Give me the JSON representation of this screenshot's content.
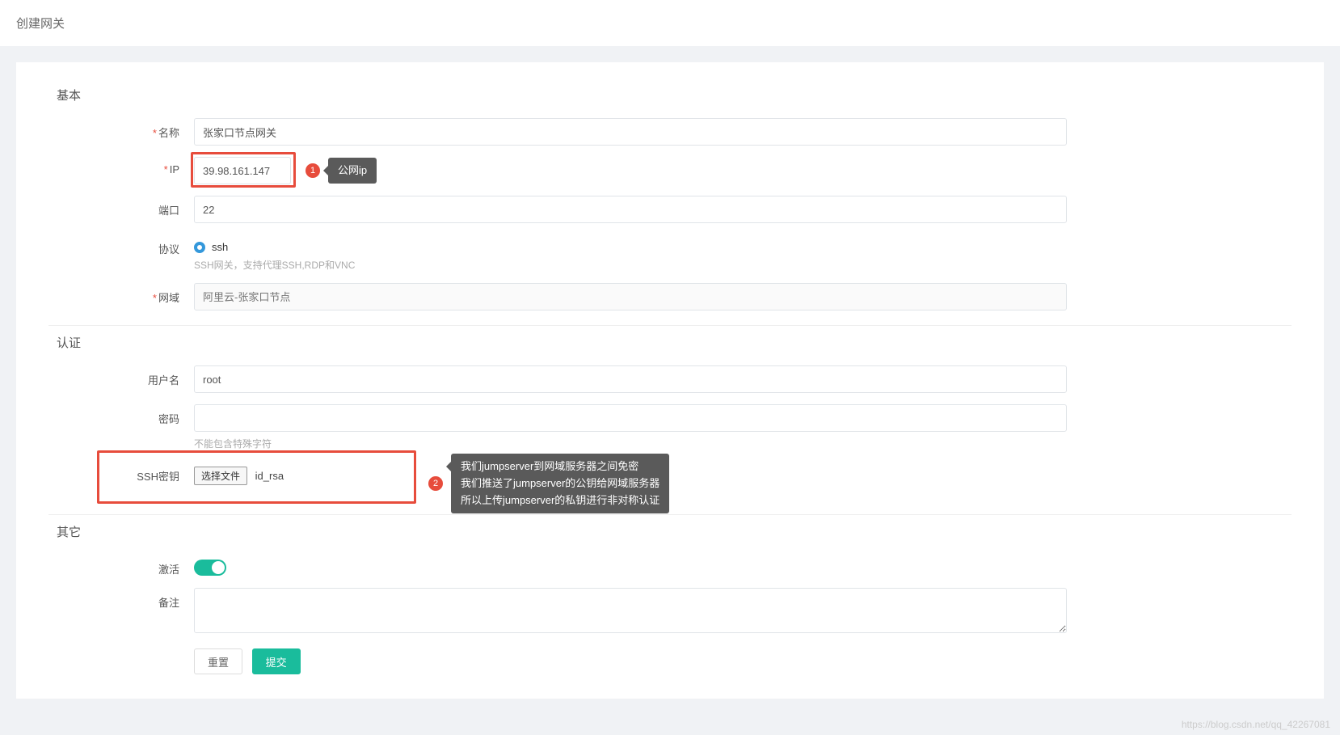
{
  "header": {
    "title": "创建网关"
  },
  "sections": {
    "basic": "基本",
    "auth": "认证",
    "other": "其它"
  },
  "basic": {
    "name_label": "名称",
    "name_value": "张家口节点网关",
    "ip_label": "IP",
    "ip_value": "39.98.161.147",
    "port_label": "端口",
    "port_value": "22",
    "proto_label": "协议",
    "proto_value": "ssh",
    "proto_help": "SSH网关，支持代理SSH,RDP和VNC",
    "domain_label": "网域",
    "domain_placeholder": "阿里云-张家口节点"
  },
  "auth": {
    "user_label": "用户名",
    "user_value": "root",
    "pass_label": "密码",
    "pass_value": "",
    "pass_help": "不能包含特殊字符",
    "sshkey_label": "SSH密钥",
    "file_btn": "选择文件",
    "file_name": "id_rsa"
  },
  "other": {
    "active_label": "激活",
    "remark_label": "备注",
    "remark_value": ""
  },
  "buttons": {
    "reset": "重置",
    "submit": "提交"
  },
  "annotations": {
    "badge1": "1",
    "tip1": "公网ip",
    "badge2": "2",
    "tip2_l1": "我们jumpserver到网域服务器之间免密",
    "tip2_l2": "我们推送了jumpserver的公钥给网域服务器",
    "tip2_l3": "所以上传jumpserver的私钥进行非对称认证"
  },
  "watermark": "https://blog.csdn.net/qq_42267081"
}
